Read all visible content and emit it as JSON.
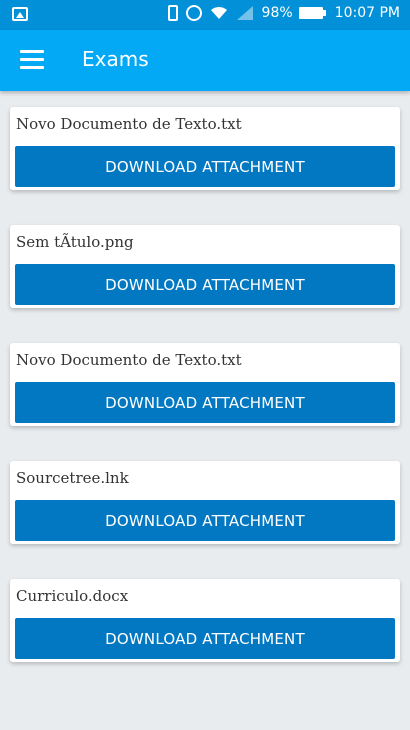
{
  "status_bar": {
    "battery": "98%",
    "time": "10:07 PM",
    "icons": [
      "image-icon",
      "vibrate-icon",
      "alarm-icon",
      "wifi-icon",
      "signal-icon",
      "battery-icon"
    ]
  },
  "app_bar": {
    "title": "Exams",
    "menu_icon": "hamburger-menu-icon"
  },
  "attachments": [
    {
      "file_name": "Novo Documento de Texto.txt",
      "button_label": "DOWNLOAD ATTACHMENT"
    },
    {
      "file_name": "Sem tÃtulo.png",
      "button_label": "DOWNLOAD ATTACHMENT"
    },
    {
      "file_name": "Novo Documento de Texto.txt",
      "button_label": "DOWNLOAD ATTACHMENT"
    },
    {
      "file_name": "Sourcetree.lnk",
      "button_label": "DOWNLOAD ATTACHMENT"
    },
    {
      "file_name": "Curriculo.docx",
      "button_label": "DOWNLOAD ATTACHMENT"
    }
  ],
  "colors": {
    "status_bar": "#0291d9",
    "app_bar": "#03a9f4",
    "button": "#0278c3",
    "background": "#e9ecef"
  }
}
